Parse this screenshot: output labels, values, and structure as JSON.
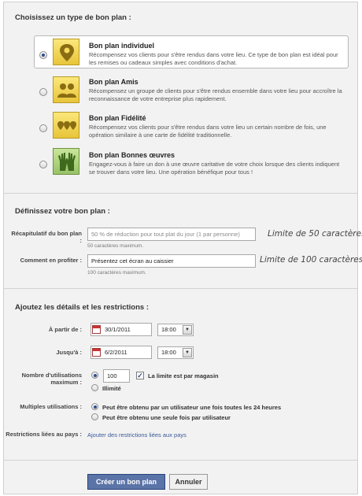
{
  "type_section": {
    "title": "Choisissez un type de bon plan :",
    "options": [
      {
        "name": "Bon plan individuel",
        "description": "Récompensez vos clients pour s'être rendus dans votre lieu. Ce type de bon plan est idéal pour les remises ou cadeaux simples avec conditions d'achat.",
        "icon": "map-pin-icon",
        "selected": true
      },
      {
        "name": "Bon plan Amis",
        "description": "Récompensez un groupe de clients pour s'être rendus ensemble dans votre lieu pour accroître la reconnaissance de votre entreprise plus rapidement.",
        "icon": "friends-icon",
        "selected": false
      },
      {
        "name": "Bon plan Fidélité",
        "description": "Récompensez vos clients pour s'être rendus dans votre lieu un certain nombre de fois, une opération similaire à une carte de fidélité traditionnelle.",
        "icon": "multiple-pins-icon",
        "selected": false
      },
      {
        "name": "Bon plan Bonnes œuvres",
        "description": "Engagez-vous à faire un don à une œuvre caritative de votre choix lorsque des clients indiquent se trouver dans votre lieu. Une opération bénéfique pour tous !",
        "icon": "raised-hands-icon",
        "selected": false
      }
    ]
  },
  "define_section": {
    "title": "Définissez votre bon plan :",
    "summary": {
      "label": "Récapitulatif du bon plan :",
      "placeholder": "50 % de réduction pour tout plat du jour (1 par personne)",
      "hint": "50 caractères maximum.",
      "limit_note": "Limite de 50 caractères"
    },
    "redeem": {
      "label": "Comment en profiter :",
      "value": "Présentez cet écran au caissier",
      "hint": "100 caractères maximum.",
      "limit_note": "Limite de 100 caractères"
    }
  },
  "details_section": {
    "title": "Ajoutez les détails et les restrictions :",
    "start": {
      "label": "À partir de :",
      "date": "30/1/2011",
      "time": "18:00"
    },
    "end": {
      "label": "Jusqu'à :",
      "date": "6/2/2011",
      "time": "18:00"
    },
    "max_uses": {
      "label": "Nombre d'utilisations maximum :",
      "value": "100",
      "per_store_label": "La limite est par magasin",
      "per_store_checked": true,
      "unlimited_label": "Illimité"
    },
    "multiple": {
      "label": "Multiples utilisations :",
      "option_24h": "Peut être obtenu par un utilisateur une fois toutes les 24 heures",
      "option_once": "Peut être obtenu une seule fois par utilisateur"
    },
    "country": {
      "label": "Restrictions liées au pays :",
      "link": "Ajouter des restrictions liées aux pays"
    }
  },
  "actions": {
    "create_label": "Créer un bon plan",
    "cancel_label": "Annuler"
  },
  "colors": {
    "accent": "#3b5998",
    "button_primary": "#5b74a8",
    "icon_yellow": "#f2d34f",
    "icon_green": "#a9cd7a"
  }
}
